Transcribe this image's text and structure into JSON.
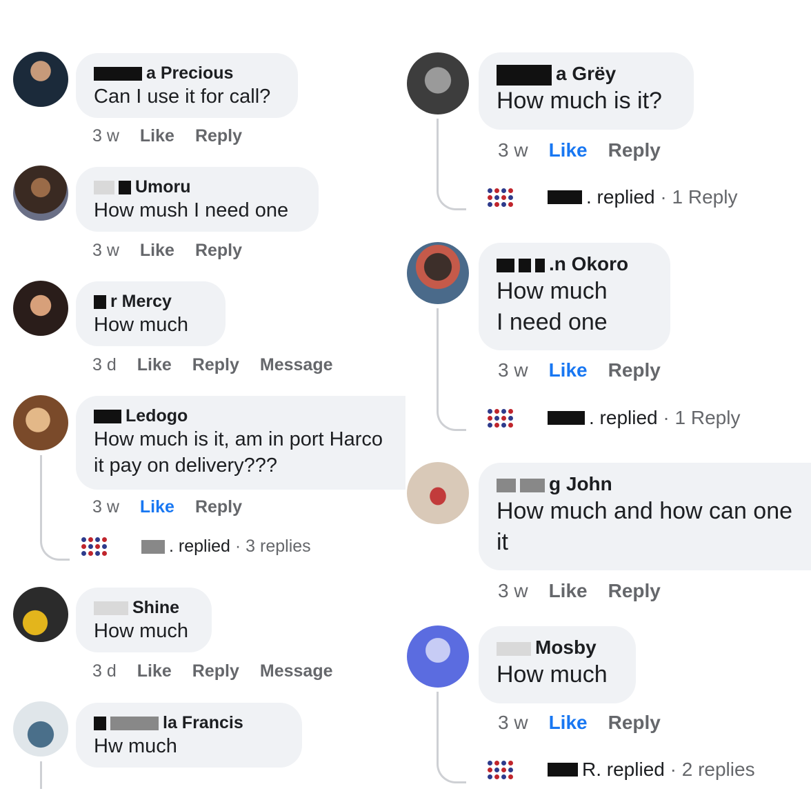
{
  "left": [
    {
      "name": "Precious",
      "text": "Can I use it for call?",
      "time": "3 w",
      "like": "Like",
      "reply": "Reply",
      "colors": [
        "#1b2a3a",
        "#c79a7a"
      ]
    },
    {
      "name": "Umoru",
      "text": "How mush I need one",
      "time": "3 w",
      "like": "Like",
      "reply": "Reply",
      "colors": [
        "#3a2a22",
        "#9a6b48"
      ]
    },
    {
      "name": "Mercy",
      "text": "How much",
      "time": "3 d",
      "like": "Like",
      "reply": "Reply",
      "message": "Message",
      "colors": [
        "#2a1d1a",
        "#d7a07a"
      ]
    },
    {
      "name": "Ledogo",
      "text": "How much is it, am in port Harco\nit pay on delivery???",
      "time": "3 w",
      "like": "Like",
      "reply": "Reply",
      "replied": ". replied",
      "replies": "3 replies",
      "colors": [
        "#7a4a2a",
        "#e3b888"
      ]
    },
    {
      "name": "Shine",
      "text": "How much",
      "time": "3 d",
      "like": "Like",
      "reply": "Reply",
      "message": "Message",
      "colors": [
        "#2b2b2b",
        "#e3b51c"
      ]
    },
    {
      "name": "la Francis",
      "text": "Hw much",
      "colors": [
        "#4a6f8a",
        "#e0e6ea"
      ]
    }
  ],
  "right": [
    {
      "name": "a Grëy",
      "text": "How much is it?",
      "time": "3 w",
      "like": "Like",
      "reply": "Reply",
      "replied": ". replied",
      "replies": "1 Reply",
      "colors": [
        "#3d3d3d",
        "#9a9a9a"
      ]
    },
    {
      "name": ".n Okoro",
      "text": "How much\nI need one",
      "time": "3 w",
      "like": "Like",
      "reply": "Reply",
      "replied": ". replied",
      "replies": "1 Reply",
      "colors": [
        "#3d2f2a",
        "#c55a4a"
      ]
    },
    {
      "name": "g John",
      "text": "How much and how can one\nit",
      "time": "3 w",
      "like": "Like",
      "reply": "Reply",
      "colors": [
        "#d9c9b8",
        "#c23b3b"
      ]
    },
    {
      "name": "Mosby",
      "text": "How much",
      "time": "3 w",
      "like": "Like",
      "reply": "Reply",
      "replied": "R. replied",
      "replies": "2 replies",
      "colors": [
        "#5b6ce0",
        "#c7ccf5"
      ]
    }
  ],
  "left_names": {
    "c1": "a Precious",
    "c2": "Umoru",
    "c3": "r Mercy",
    "c4": "Ledogo",
    "c5": "Shine",
    "c6": "la Francis"
  },
  "right_names": {
    "c1": "a Grëy",
    "c2": ".n Okoro",
    "c3": "g John",
    "c4": "Mosby"
  },
  "replied_labels": {
    "ledogo": ". replied",
    "grey": ". replied",
    "okoro": ". replied",
    "mosby": "R. replied"
  },
  "accent": "#1877f2",
  "muted": "#65676b",
  "bubble_bg": "#f0f2f5"
}
